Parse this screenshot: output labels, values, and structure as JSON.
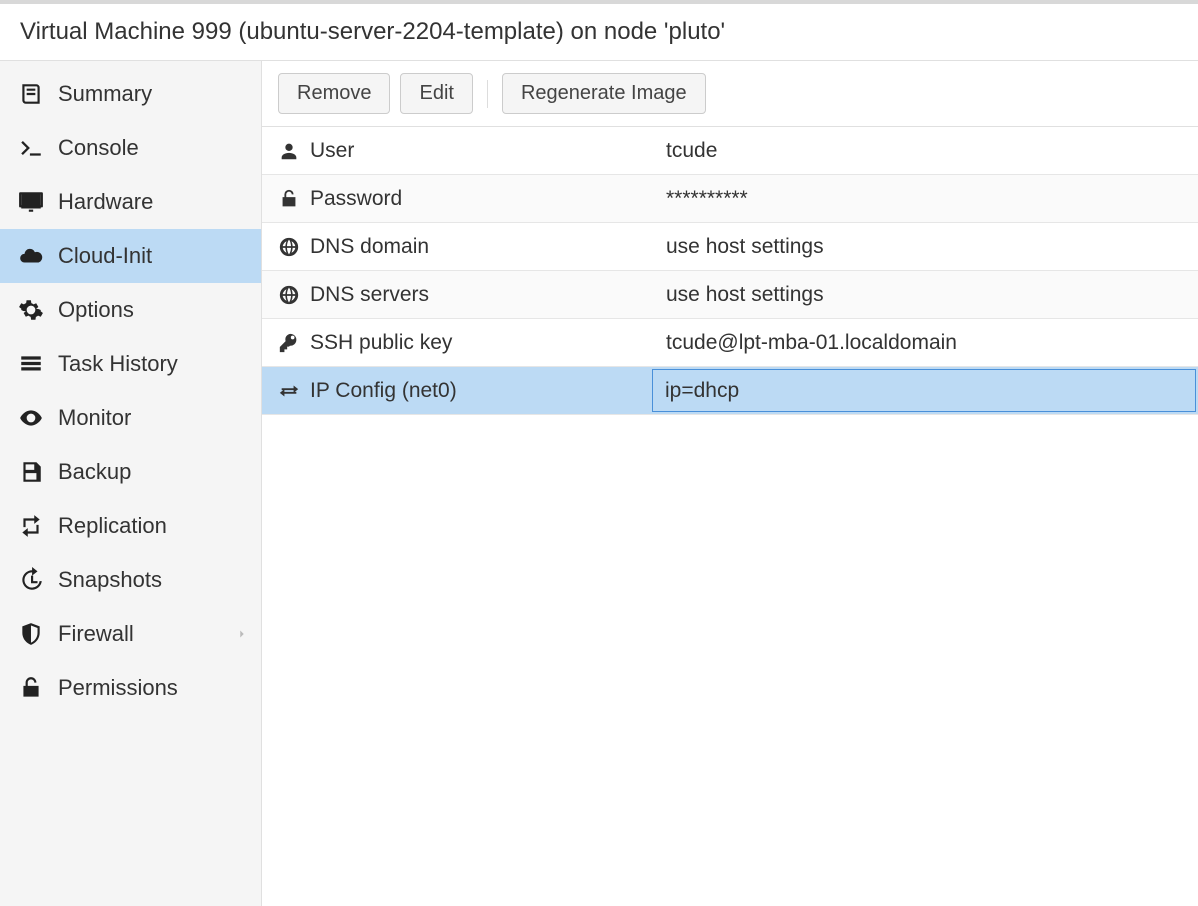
{
  "header": {
    "title": "Virtual Machine 999 (ubuntu-server-2204-template) on node 'pluto'"
  },
  "sidebar": {
    "items": [
      {
        "id": "summary",
        "label": "Summary",
        "icon": "book-icon"
      },
      {
        "id": "console",
        "label": "Console",
        "icon": "terminal-icon"
      },
      {
        "id": "hardware",
        "label": "Hardware",
        "icon": "desktop-icon"
      },
      {
        "id": "cloud-init",
        "label": "Cloud-Init",
        "icon": "cloud-icon",
        "active": true
      },
      {
        "id": "options",
        "label": "Options",
        "icon": "gear-icon"
      },
      {
        "id": "task-history",
        "label": "Task History",
        "icon": "list-icon"
      },
      {
        "id": "monitor",
        "label": "Monitor",
        "icon": "eye-icon"
      },
      {
        "id": "backup",
        "label": "Backup",
        "icon": "save-icon"
      },
      {
        "id": "replication",
        "label": "Replication",
        "icon": "retweet-icon"
      },
      {
        "id": "snapshots",
        "label": "Snapshots",
        "icon": "history-icon"
      },
      {
        "id": "firewall",
        "label": "Firewall",
        "icon": "shield-icon",
        "expandable": true
      },
      {
        "id": "permissions",
        "label": "Permissions",
        "icon": "unlock-icon"
      }
    ]
  },
  "toolbar": {
    "remove_label": "Remove",
    "edit_label": "Edit",
    "regenerate_label": "Regenerate Image"
  },
  "rows": [
    {
      "icon": "user-icon",
      "label": "User",
      "value": "tcude"
    },
    {
      "icon": "unlock-icon",
      "label": "Password",
      "value": "**********"
    },
    {
      "icon": "globe-icon",
      "label": "DNS domain",
      "value": "use host settings"
    },
    {
      "icon": "globe-icon",
      "label": "DNS servers",
      "value": "use host settings"
    },
    {
      "icon": "key-icon",
      "label": "SSH public key",
      "value": "tcude@lpt-mba-01.localdomain"
    },
    {
      "icon": "exchange-icon",
      "label": "IP Config (net0)",
      "value": "ip=dhcp",
      "selected": true
    }
  ]
}
